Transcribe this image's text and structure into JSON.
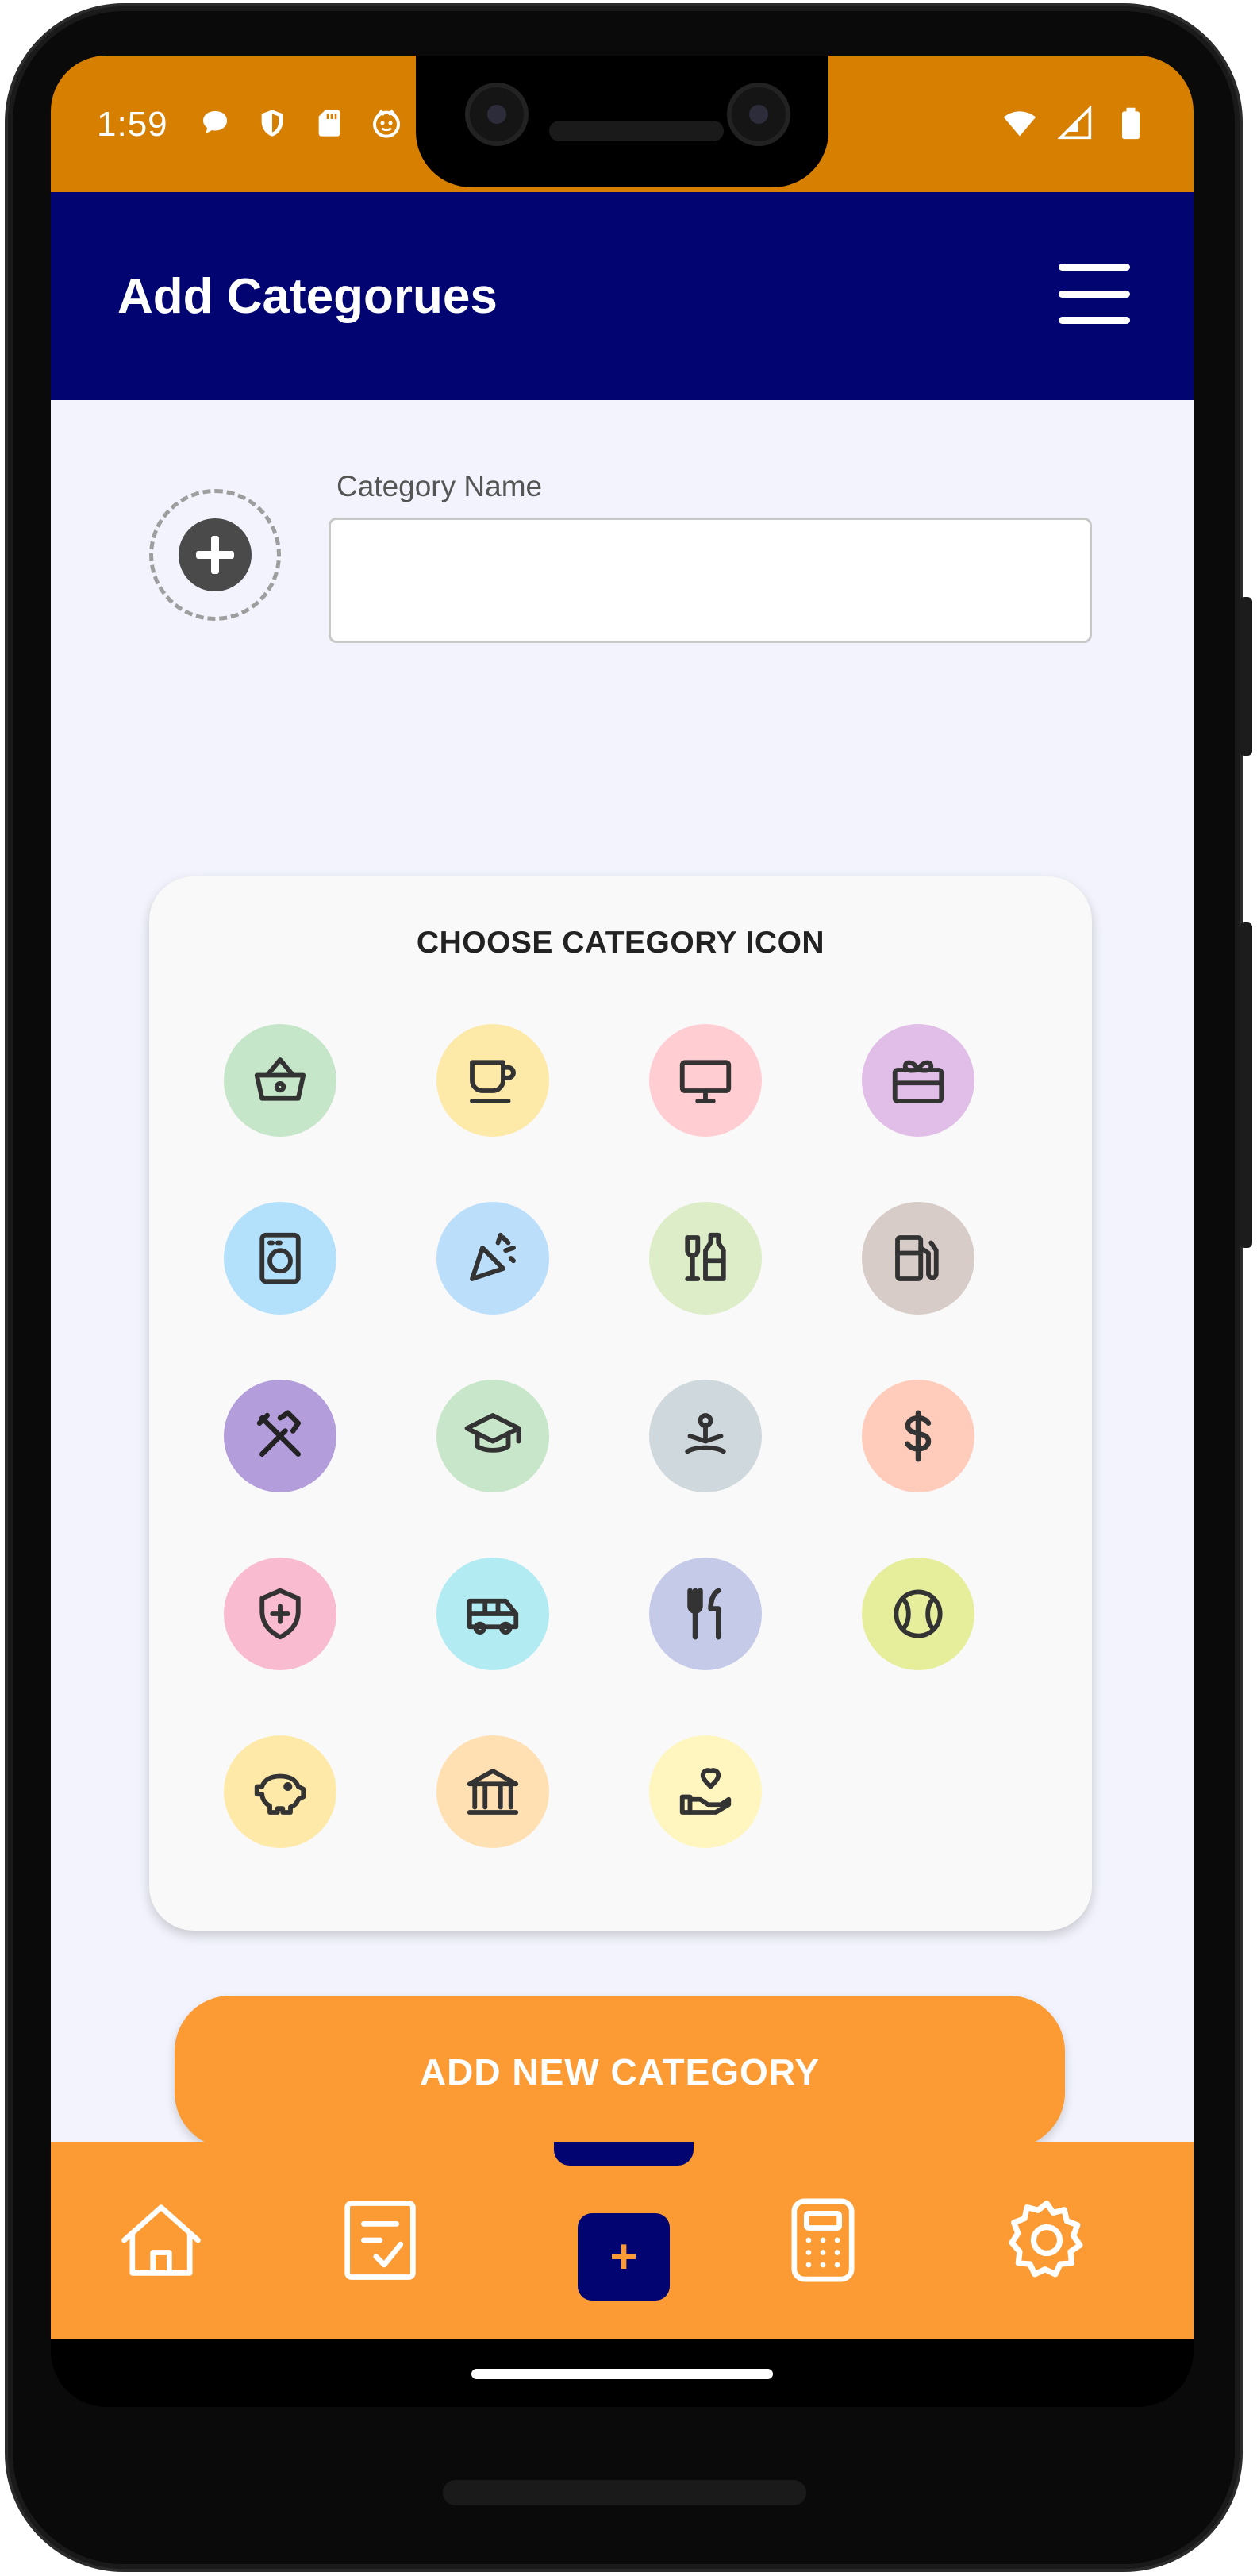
{
  "status_bar": {
    "time": "1:59",
    "left_icons": [
      "chat-bubble-icon",
      "shield-icon",
      "sd-card-icon",
      "face-icon"
    ],
    "right_icons": [
      "wifi-icon",
      "signal-icon",
      "battery-icon"
    ],
    "background": "#d77f00"
  },
  "header": {
    "title": "Add Categorues",
    "menu_icon": "hamburger-menu-icon",
    "background": "#020571"
  },
  "form": {
    "icon_picker_icon": "add-circle-icon",
    "category_name_label": "Category Name",
    "category_name_value": "",
    "category_name_placeholder": ""
  },
  "icon_card": {
    "title": "CHOOSE CATEGORY ICON",
    "icons": [
      {
        "name": "basket-icon",
        "bg": "#c6e6c9"
      },
      {
        "name": "coffee-cup-icon",
        "bg": "#fde9a8"
      },
      {
        "name": "monitor-icon",
        "bg": "#ffcdd2"
      },
      {
        "name": "gift-icon",
        "bg": "#e1bee7"
      },
      {
        "name": "washing-machine-icon",
        "bg": "#b3e0fb"
      },
      {
        "name": "party-popper-icon",
        "bg": "#bbdefb"
      },
      {
        "name": "bottles-icon",
        "bg": "#dcedc8"
      },
      {
        "name": "fuel-pump-icon",
        "bg": "#d7ccc8"
      },
      {
        "name": "tools-icon",
        "bg": "#b39ddb"
      },
      {
        "name": "graduation-cap-icon",
        "bg": "#c8e6c9"
      },
      {
        "name": "meditation-icon",
        "bg": "#cfd8dc"
      },
      {
        "name": "dollar-icon",
        "bg": "#ffccbc"
      },
      {
        "name": "health-shield-icon",
        "bg": "#f8bbd0"
      },
      {
        "name": "bus-icon",
        "bg": "#b2ebf2"
      },
      {
        "name": "restaurant-icon",
        "bg": "#c5cae9"
      },
      {
        "name": "tennis-ball-icon",
        "bg": "#e6ee9c"
      },
      {
        "name": "piggy-bank-icon",
        "bg": "#ffe9a8"
      },
      {
        "name": "bank-icon",
        "bg": "#ffe0b2"
      },
      {
        "name": "charity-heart-icon",
        "bg": "#fff6bf"
      }
    ]
  },
  "primary_action": {
    "label": "ADD NEW CATEGORY",
    "color": "#fc9b33"
  },
  "bottom_nav": {
    "items": [
      "home-icon",
      "task-list-icon",
      "add-icon",
      "calculator-icon",
      "settings-gear-icon"
    ],
    "add_label": "+",
    "active": "add-icon",
    "background": "#fc9b33",
    "accent": "#020571"
  }
}
